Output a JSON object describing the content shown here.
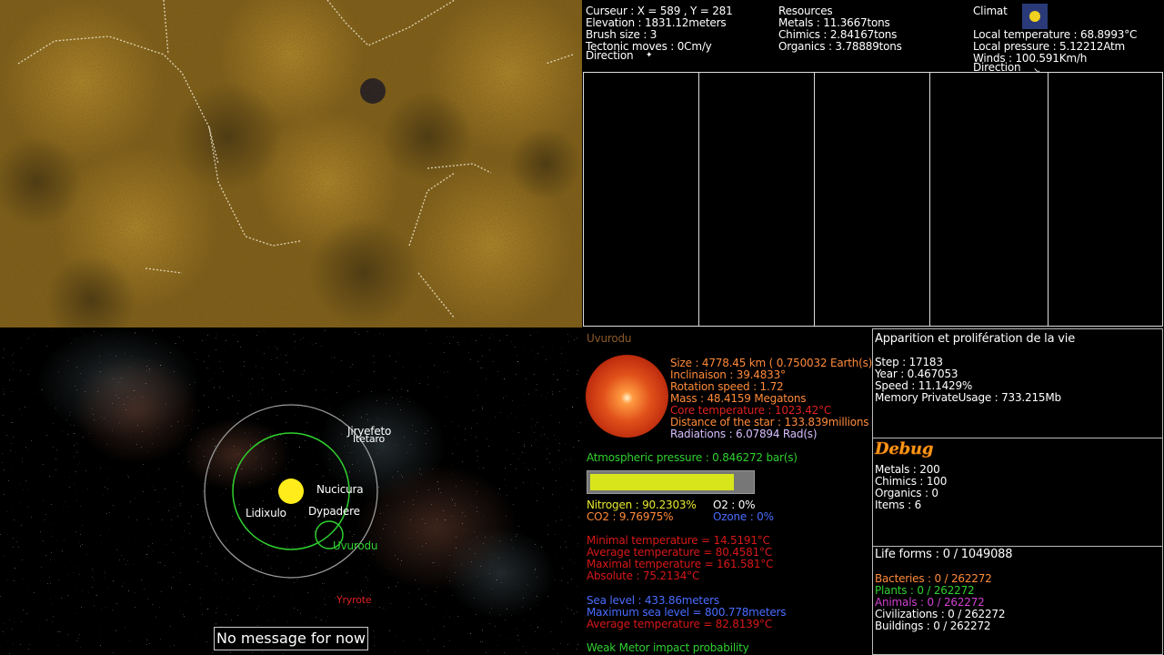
{
  "terrain": {
    "description_colors": [
      "#8b6515",
      "#a97d20",
      "#5e4410"
    ]
  },
  "hud": {
    "cursor": "Curseur : X = 589 , Y = 281",
    "elevation": "Elevation : 1831.12meters",
    "brush": "Brush size : 3",
    "tectonic": "Tectonic moves : 0Cm/y",
    "direction": "Direction",
    "resources_title": "Resources",
    "metals": "Metals : 11.3667tons",
    "chimics": "Chimics : 2.84167tons",
    "organics": "Organics : 3.78889tons",
    "climat_title": "Climat",
    "local_temp": "Local temperature : 68.8993°C",
    "local_pressure": "Local pressure : 5.12212Atm",
    "winds": "Winds : 100.591Km/h",
    "wind_direction": "Direction"
  },
  "space": {
    "bodies": [
      {
        "name": "Jiryefeto",
        "color": "#ffffff"
      },
      {
        "name": "Itetaro",
        "color": "#ffffff"
      },
      {
        "name": "Nucicura",
        "color": "#ffffff"
      },
      {
        "name": "Lidixulo",
        "color": "#ffffff"
      },
      {
        "name": "Dypadere",
        "color": "#ffffff"
      },
      {
        "name": "Uvurodu",
        "color": "#2fd02f"
      },
      {
        "name": "Yryrote",
        "color": "#e02020"
      }
    ],
    "message": "No message for now"
  },
  "planet": {
    "name": "Uvurodu",
    "size": "Size : 4778.45 km ( 0.750032 Earth(s))",
    "inclinaison": "Inclinaison : 39.4833°",
    "rotation": "Rotation speed : 1.72",
    "mass": "Mass : 48.4159 Megatons",
    "core_temp": "Core temperature : 1023.42°C",
    "distance": "Distance of the star : 133.839millions kms",
    "radiations": "Radiations : 6.07894 Rad(s)",
    "atmo_pressure": "Atmospheric pressure : 0.846272 bar(s)",
    "atmo_fill": 0.89,
    "nitrogen": "Nitrogen : 90.2303%",
    "o2": "O2 : 0%",
    "co2": "CO2 : 9.76975%",
    "ozone": "Ozone : 0%",
    "min_temp": "Minimal temperature = 14.5191°C",
    "avg_temp": "Average temperature = 80.4581°C",
    "max_temp": "Maximal temperature = 161.581°C",
    "absolute": "Absolute : 75.2134°C",
    "sea_level": "Sea level : 433.86meters",
    "max_sea_level": "Maximum sea level = 800.778meters",
    "avg_temp2": "Average temperature = 82.8139°C",
    "meteor": "Weak Metor impact probability"
  },
  "stats": {
    "title": "Apparition et prolifération de la vie",
    "step": "Step : 17183",
    "year": "Year : 0.467053",
    "speed": "Speed : 11.1429%",
    "memory": "Memory PrivateUsage : 733.215Mb"
  },
  "debug": {
    "title": "Debug",
    "metals": "Metals : 200",
    "chimics": "Chimics : 100",
    "organics": "Organics : 0",
    "items": "Items : 6"
  },
  "life": {
    "title": "Life forms : 0 / 1049088",
    "bacteries": "Bacteries : 0 / 262272",
    "plants": "Plants : 0 / 262272",
    "animals": "Animals : 0 / 262272",
    "civilizations": "Civilizations : 0 / 262272",
    "buildings": "Buildings : 0 / 262272"
  },
  "colors": {
    "orange_text": "#ff8a3a",
    "red_text": "#e02020",
    "green_text": "#2fd02f",
    "blue_text": "#4a6cff",
    "yellow_text": "#e8e830",
    "purple_text": "#d040d0",
    "bar": "#d8e51b"
  }
}
